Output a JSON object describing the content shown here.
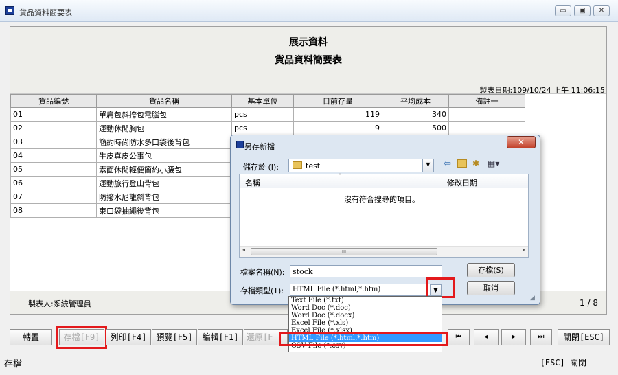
{
  "window": {
    "title": "貨品資料簡要表",
    "controls": [
      "▭",
      "▣",
      "✕"
    ]
  },
  "report": {
    "title1": "展示資料",
    "title2": "貨品資料簡要表",
    "date_label": "製表日期:109/10/24 上午 11:06:15",
    "columns": [
      "貨品編號",
      "貨品名稱",
      "基本單位",
      "目前存量",
      "平均成本",
      "備註一"
    ],
    "rows": [
      {
        "id": "01",
        "name": "單肩包斜挎包電腦包",
        "unit": "pcs",
        "stock": "119",
        "cost": "340"
      },
      {
        "id": "02",
        "name": "運動休閒胸包",
        "unit": "pcs",
        "stock": "9",
        "cost": "500"
      },
      {
        "id": "03",
        "name": "簡約時尚防水多口袋後背包",
        "unit": "",
        "stock": "",
        "cost": ""
      },
      {
        "id": "04",
        "name": "牛皮真皮公事包",
        "unit": "",
        "stock": "",
        "cost": ""
      },
      {
        "id": "05",
        "name": "素面休閒輕便簡約小腰包",
        "unit": "",
        "stock": "",
        "cost": ""
      },
      {
        "id": "06",
        "name": "運動旅行登山背包",
        "unit": "",
        "stock": "",
        "cost": ""
      },
      {
        "id": "07",
        "name": "防撥水尼龍斜背包",
        "unit": "",
        "stock": "",
        "cost": ""
      },
      {
        "id": "08",
        "name": "束口袋抽繩後背包",
        "unit": "",
        "stock": "",
        "cost": ""
      }
    ],
    "maker": "製表人:系統管理員",
    "page": "1 / 8"
  },
  "toolbar": {
    "transfer": "轉置",
    "save": "存檔[F9]",
    "print": "列印[F4]",
    "preview": "預覽[F5]",
    "edit": "編輯[F1]",
    "restore": "還原[F",
    "first": "⏮",
    "prev": "◀",
    "next": "▶",
    "last": "⏭",
    "close": "關閉[ESC]"
  },
  "status": {
    "left": "存檔",
    "right": "[ESC] 關閉"
  },
  "dialog": {
    "title": "另存新檔",
    "save_in_label": "儲存於 (I):",
    "save_in_value": "test",
    "col_name": "名稱",
    "col_date": "修改日期",
    "empty_text": "沒有符合搜尋的項目。",
    "scroll_mark": "III",
    "filename_label": "檔案名稱(N):",
    "filename_value": "stock",
    "filetype_label": "存檔類型(T):",
    "filetype_value": "HTML File (*.html,*.htm)",
    "save_button": "存檔(S)",
    "cancel_button": "取消",
    "filetype_options": [
      "Text File (*.txt)",
      "Word Doc (*.doc)",
      "Word Doc (*.docx)",
      "Excel File (*.xls)",
      "Excel File (*.xlsx)",
      "HTML File (*.html,*.htm)",
      "CSV File (*.csv)"
    ]
  }
}
